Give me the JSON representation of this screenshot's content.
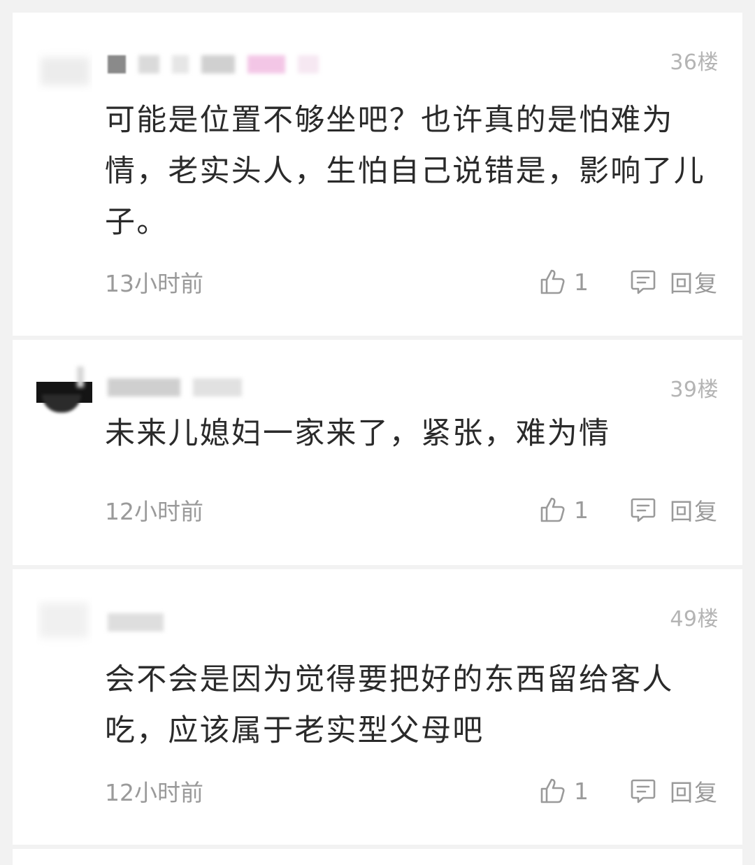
{
  "comments": [
    {
      "floor": "36楼",
      "text": "可能是位置不够坐吧？也许真的是怕难为情，老实头人，生怕自己说错是，影响了儿子。",
      "time": "13小时前",
      "likes": "1",
      "reply_label": "回复"
    },
    {
      "floor": "39楼",
      "text": "未来儿媳妇一家来了，紧张，难为情",
      "time": "12小时前",
      "likes": "1",
      "reply_label": "回复"
    },
    {
      "floor": "49楼",
      "text": "会不会是因为觉得要把好的东西留给客人吃，应该属于老实型父母吧",
      "time": "12小时前",
      "likes": "1",
      "reply_label": "回复"
    }
  ],
  "icons": {
    "like": "thumbs-up-icon",
    "reply": "comment-icon"
  },
  "colors": {
    "background": "#f2f2f2",
    "card": "#ffffff",
    "text": "#2a2a2a",
    "meta": "#9a9a9a",
    "floor": "#b4b4b4"
  }
}
